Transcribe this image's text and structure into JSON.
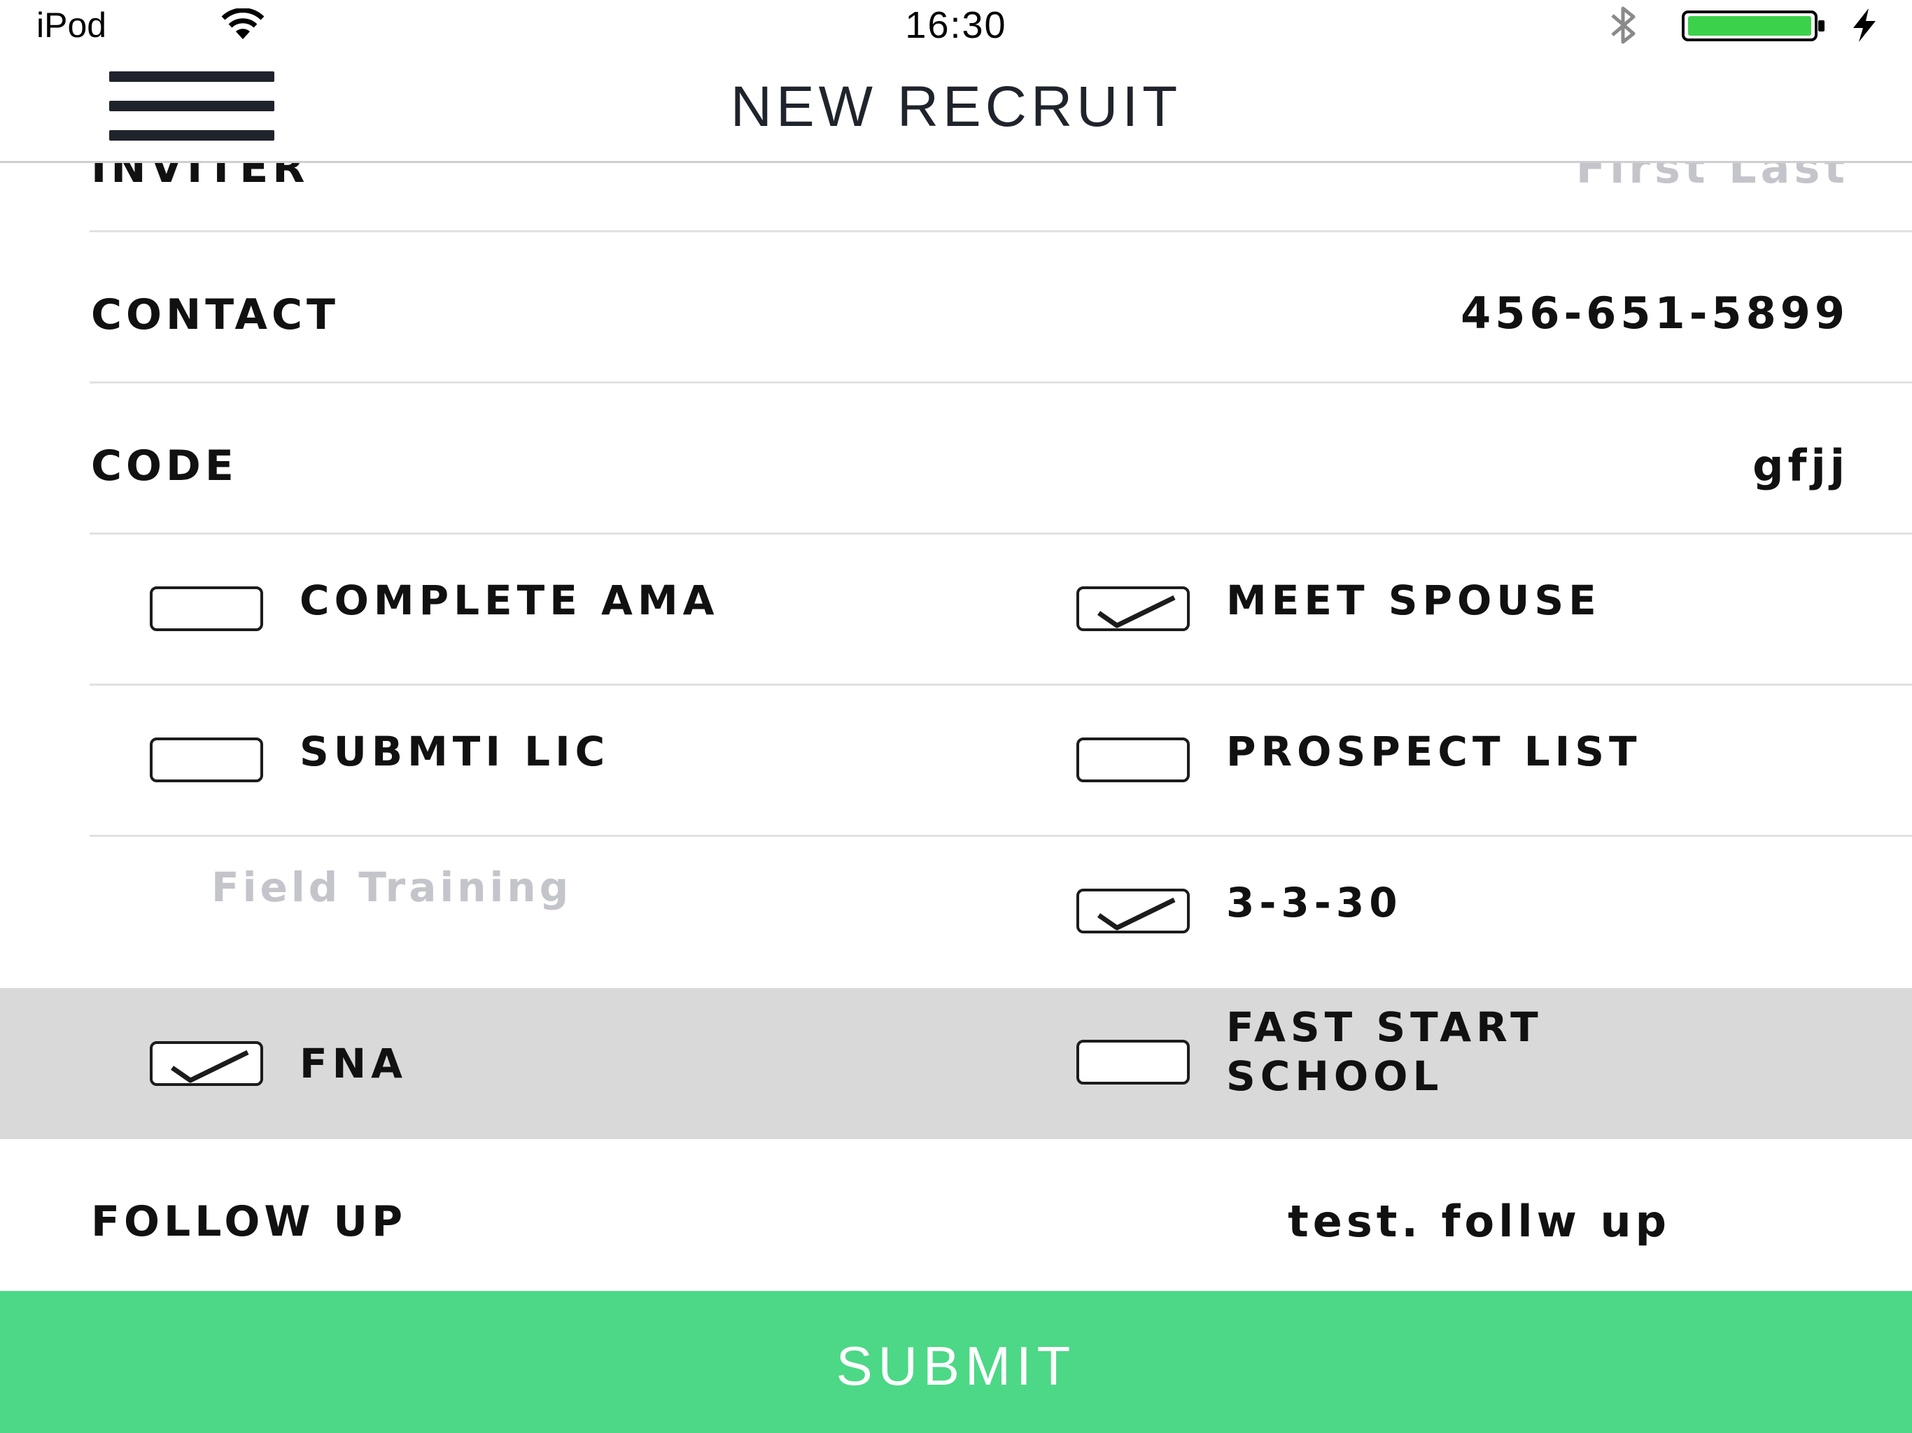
{
  "status_bar": {
    "carrier": "iPod",
    "time": "16:30",
    "battery_color": "#3bd14a"
  },
  "nav": {
    "menu_icon": "hamburger-menu-icon",
    "title": "NEW RECRUIT"
  },
  "form": {
    "inviter": {
      "label": "INVITER",
      "placeholder": "First Last"
    },
    "contact": {
      "label": "CONTACT",
      "value": "456-651-5899"
    },
    "code": {
      "label": "CODE",
      "value": "gfjj"
    },
    "checklist": {
      "complete_ama": {
        "label": "COMPLETE AMA",
        "checked": false
      },
      "meet_spouse": {
        "label": "MEET SPOUSE",
        "checked": true
      },
      "submti_lic": {
        "label": "SUBMTI LIC",
        "checked": false
      },
      "prospect_list": {
        "label": "PROSPECT LIST",
        "checked": false
      },
      "field_training": {
        "placeholder": "Field Training"
      },
      "three_three_thirty": {
        "label": "3-3-30",
        "checked": true
      },
      "fna": {
        "label": "FNA",
        "checked": true
      },
      "fast_start_school": {
        "label_line1": "FAST START",
        "label_line2": "SCHOOL",
        "checked": false
      }
    },
    "follow_up": {
      "label": "FOLLOW UP",
      "value": "test. follw  up"
    }
  },
  "submit": {
    "label": "SUBMIT",
    "color": "#4cd886"
  }
}
